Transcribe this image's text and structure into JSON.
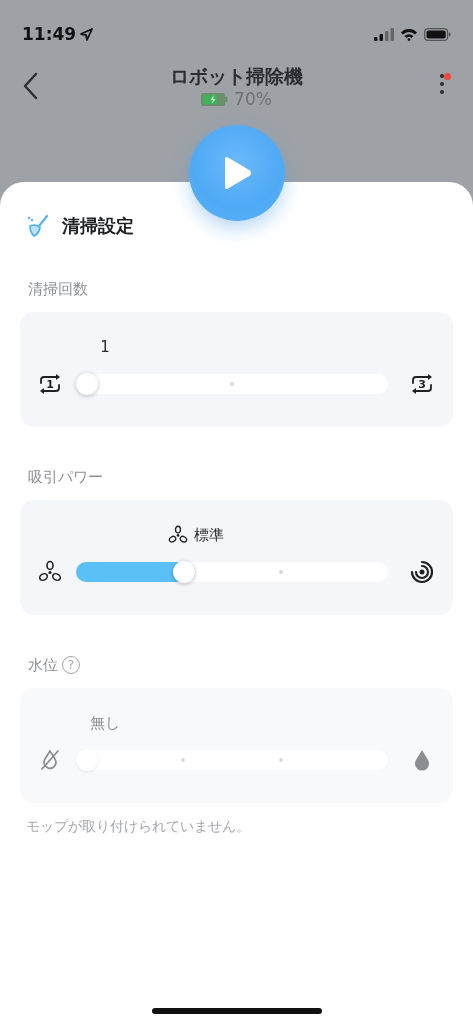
{
  "status_bar": {
    "time": "11:49"
  },
  "header": {
    "title": "ロボット掃除機",
    "battery": "70%",
    "menu_badge": true
  },
  "section": {
    "title": "清掃設定"
  },
  "settings": [
    {
      "kind": "count",
      "label": "清掃回数",
      "value": "1",
      "level": 0,
      "disabled": false,
      "min_icon_text": "1",
      "max_icon_text": "3"
    },
    {
      "kind": "suction",
      "label": "吸引パワー",
      "value": "標準",
      "level": 0.333,
      "disabled": false
    },
    {
      "kind": "water",
      "label": "水位",
      "help": "?",
      "value": "無し",
      "level": 0,
      "disabled": true,
      "note": "モップが取り付けられていません。"
    }
  ]
}
